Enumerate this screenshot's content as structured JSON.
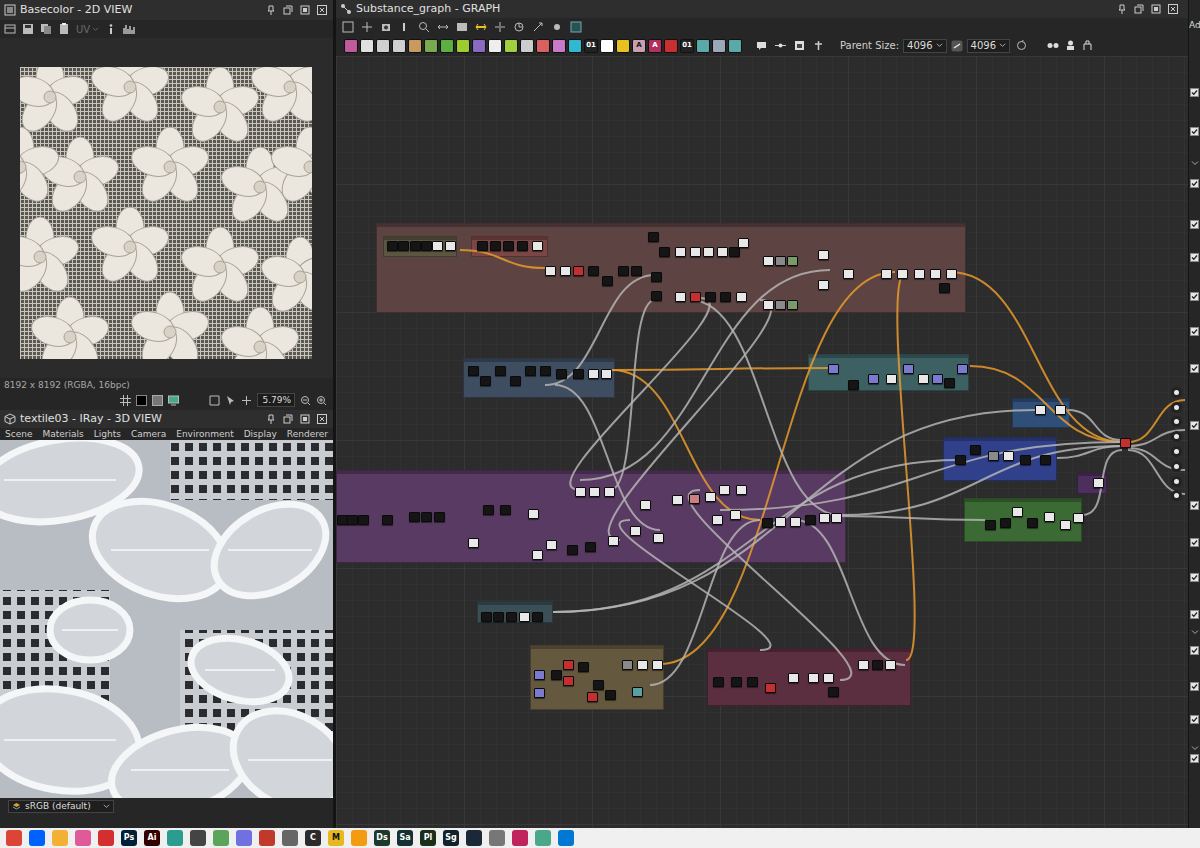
{
  "panels": {
    "view2d": {
      "title": "Basecolor - 2D VIEW",
      "uv": "UV",
      "info": "8192 x 8192 (RGBA, 16bpc)",
      "zoom": "5.79%"
    },
    "view3d": {
      "title": "textile03 - IRay - 3D VIEW",
      "menu": [
        "Scene",
        "Materials",
        "Lights",
        "Camera",
        "Environment",
        "Display",
        "Renderer"
      ],
      "colorspace": "sRGB (default)"
    },
    "graph": {
      "title": "Substance_graph - GRAPH",
      "parent_size_label": "Parent Size:",
      "parent_size": "4096",
      "output_size": "4096",
      "toolbar_icons": [
        {
          "color": "#c05a9a"
        },
        {
          "color": "#e0e0e0"
        },
        {
          "color": "#cfcfcf"
        },
        {
          "color": "#cfcfcf"
        },
        {
          "color": "#c89a60"
        },
        {
          "color": "#7aaa50"
        },
        {
          "color": "#5ab040"
        },
        {
          "color": "#9ccc30"
        },
        {
          "color": "#8a6ac0"
        },
        {
          "color": "#eeeeee"
        },
        {
          "color": "#a0d040"
        },
        {
          "color": "#cccccc"
        },
        {
          "color": "#d86060"
        },
        {
          "color": "#c87ac8"
        },
        {
          "color": "#30b8d0"
        },
        {
          "color": "#222222",
          "glyph": "01"
        },
        {
          "color": "#ffffff"
        },
        {
          "color": "#e8c020"
        },
        {
          "color": "#c8a0b0",
          "glyph": "A"
        },
        {
          "color": "#b03060",
          "glyph": "A"
        },
        {
          "color": "#c83030"
        },
        {
          "color": "#222222",
          "glyph": "01"
        },
        {
          "color": "#5aa8a8"
        },
        {
          "color": "#9aa8b8"
        },
        {
          "color": "#5aa8a8"
        }
      ],
      "frames": [
        {
          "color": "#5e4343"
        },
        {
          "color": "#5b5640"
        },
        {
          "color": "#7a4646"
        },
        {
          "color": "#3e4d60"
        },
        {
          "color": "#3d6163"
        },
        {
          "color": "#2f4f78"
        },
        {
          "color": "#30408a"
        },
        {
          "color": "#583a62"
        },
        {
          "color": "#4c2f5c"
        },
        {
          "color": "#3b6a34"
        },
        {
          "color": "#3a5056"
        },
        {
          "color": "#64593f"
        },
        {
          "color": "#5b2f40"
        }
      ],
      "wires": [
        {
          "color": "#e89a2c"
        },
        {
          "color": "#e89a2c"
        },
        {
          "color": "#e89a2c"
        },
        {
          "color": "#e89a2c"
        },
        {
          "color": "#e89a2c"
        },
        {
          "color": "#e89a2c"
        },
        {
          "color": "#e89a2c"
        },
        {
          "color": "#e89a2c"
        },
        {
          "color": "#b4b4b4"
        },
        {
          "color": "#b4b4b4"
        },
        {
          "color": "#b4b4b4"
        },
        {
          "color": "#b4b4b4"
        },
        {
          "color": "#b4b4b4"
        },
        {
          "color": "#b4b4b4"
        },
        {
          "color": "#b4b4b4"
        },
        {
          "color": "#b4b4b4"
        },
        {
          "color": "#b4b4b4"
        },
        {
          "color": "#b4b4b4"
        },
        {
          "color": "#b4b4b4"
        },
        {
          "color": "#b4b4b4"
        },
        {
          "color": "#b4b4b4"
        },
        {
          "color": "#b4b4b4"
        },
        {
          "color": "#b4b4b4"
        },
        {
          "color": "#b4b4b4"
        },
        {
          "color": "#b4b4b4"
        },
        {
          "color": "#b4b4b4"
        },
        {
          "color": "#b4b4b4"
        },
        {
          "color": "#b4b4b4"
        },
        {
          "color": "#b4b4b4"
        },
        {
          "color": "#b4b4b4"
        }
      ],
      "nodes": [
        {
          "color": "#151515"
        },
        {
          "color": "#151515"
        },
        {
          "color": "#151515"
        },
        {
          "color": "#151515"
        },
        {
          "color": "#e8e8e8"
        },
        {
          "color": "#e8e8e8"
        },
        {
          "color": "#151515"
        },
        {
          "color": "#151515"
        },
        {
          "color": "#151515"
        },
        {
          "color": "#151515"
        },
        {
          "color": "#e8e8e8"
        },
        {
          "color": "#e8e8e8"
        },
        {
          "color": "#e8e8e8"
        },
        {
          "color": "#c43030"
        },
        {
          "color": "#151515"
        },
        {
          "color": "#151515"
        },
        {
          "color": "#151515"
        },
        {
          "color": "#151515"
        },
        {
          "color": "#151515"
        },
        {
          "color": "#151515"
        },
        {
          "color": "#e8e8e8"
        },
        {
          "color": "#e8e8e8"
        },
        {
          "color": "#e8e8e8"
        },
        {
          "color": "#e8e8e8"
        },
        {
          "color": "#151515"
        },
        {
          "color": "#e8e8e8"
        },
        {
          "color": "#151515"
        },
        {
          "color": "#151515"
        },
        {
          "color": "#e8e8e8"
        },
        {
          "color": "#c43030"
        },
        {
          "color": "#151515"
        },
        {
          "color": "#151515"
        },
        {
          "color": "#e8e8e8"
        },
        {
          "color": "#e8e8e8"
        },
        {
          "color": "#8a8a8a"
        },
        {
          "color": "#7a9a6a"
        },
        {
          "color": "#e8e8e8"
        },
        {
          "color": "#8a8a8a"
        },
        {
          "color": "#7a9a6a"
        },
        {
          "color": "#e8e8e8"
        },
        {
          "color": "#e8e8e8"
        },
        {
          "color": "#e8e8e8"
        },
        {
          "color": "#e8e8e8"
        },
        {
          "color": "#e8e8e8"
        },
        {
          "color": "#e8e8e8"
        },
        {
          "color": "#e8e8e8"
        },
        {
          "color": "#e8e8e8"
        },
        {
          "color": "#151515"
        },
        {
          "color": "#151515"
        },
        {
          "color": "#151515"
        },
        {
          "color": "#151515"
        },
        {
          "color": "#151515"
        },
        {
          "color": "#151515"
        },
        {
          "color": "#151515"
        },
        {
          "color": "#151515"
        },
        {
          "color": "#151515"
        },
        {
          "color": "#e8e8e8"
        },
        {
          "color": "#e8e8e8"
        },
        {
          "color": "#7a7ad0"
        },
        {
          "color": "#151515"
        },
        {
          "color": "#7a7ad0"
        },
        {
          "color": "#e8e8e8"
        },
        {
          "color": "#7a7ad0"
        },
        {
          "color": "#e8e8e8"
        },
        {
          "color": "#7a7ad0"
        },
        {
          "color": "#151515"
        },
        {
          "color": "#7a7ad0"
        },
        {
          "color": "#e8e8e8"
        },
        {
          "color": "#e8e8e8"
        },
        {
          "color": "#151515"
        },
        {
          "color": "#151515"
        },
        {
          "color": "#8a8a8a"
        },
        {
          "color": "#e8e8e8"
        },
        {
          "color": "#151515"
        },
        {
          "color": "#151515"
        },
        {
          "color": "#151515"
        },
        {
          "color": "#151515"
        },
        {
          "color": "#151515"
        },
        {
          "color": "#151515"
        },
        {
          "color": "#151515"
        },
        {
          "color": "#151515"
        },
        {
          "color": "#151515"
        },
        {
          "color": "#e8e8e8"
        },
        {
          "color": "#151515"
        },
        {
          "color": "#151515"
        },
        {
          "color": "#e8e8e8"
        },
        {
          "color": "#e8e8e8"
        },
        {
          "color": "#e8e8e8"
        },
        {
          "color": "#e8e8e8"
        },
        {
          "color": "#e8e8e8"
        },
        {
          "color": "#e8e8e8"
        },
        {
          "color": "#151515"
        },
        {
          "color": "#151515"
        },
        {
          "color": "#e8e8e8"
        },
        {
          "color": "#e8e8e8"
        },
        {
          "color": "#e8e8e8"
        },
        {
          "color": "#e8e8e8"
        },
        {
          "color": "#e8e8e8"
        },
        {
          "color": "#c88080"
        },
        {
          "color": "#e8e8e8"
        },
        {
          "color": "#e8e8e8"
        },
        {
          "color": "#e8e8e8"
        },
        {
          "color": "#e8e8e8"
        },
        {
          "color": "#e8e8e8"
        },
        {
          "color": "#151515"
        },
        {
          "color": "#e8e8e8"
        },
        {
          "color": "#e8e8e8"
        },
        {
          "color": "#151515"
        },
        {
          "color": "#e8e8e8"
        },
        {
          "color": "#e8e8e8"
        },
        {
          "color": "#151515"
        },
        {
          "color": "#151515"
        },
        {
          "color": "#e8e8e8"
        },
        {
          "color": "#151515"
        },
        {
          "color": "#e8e8e8"
        },
        {
          "color": "#e8e8e8"
        },
        {
          "color": "#e8e8e8"
        },
        {
          "color": "#e8e8e8"
        },
        {
          "color": "#151515"
        },
        {
          "color": "#151515"
        },
        {
          "color": "#151515"
        },
        {
          "color": "#e8e8e8"
        },
        {
          "color": "#151515"
        },
        {
          "color": "#7a7ad0"
        },
        {
          "color": "#7a7ad0"
        },
        {
          "color": "#151515"
        },
        {
          "color": "#c43030"
        },
        {
          "color": "#c43030"
        },
        {
          "color": "#151515"
        },
        {
          "color": "#151515"
        },
        {
          "color": "#c43030"
        },
        {
          "color": "#8a8a8a"
        },
        {
          "color": "#e8e8e8"
        },
        {
          "color": "#e8e8e8"
        },
        {
          "color": "#151515"
        },
        {
          "color": "#5aa0a0"
        },
        {
          "color": "#151515"
        },
        {
          "color": "#151515"
        },
        {
          "color": "#151515"
        },
        {
          "color": "#c43030"
        },
        {
          "color": "#e8e8e8"
        },
        {
          "color": "#e8e8e8"
        },
        {
          "color": "#e8e8e8"
        },
        {
          "color": "#151515"
        },
        {
          "color": "#e8e8e8"
        },
        {
          "color": "#151515"
        },
        {
          "color": "#e8e8e8"
        },
        {
          "color": "#c43030"
        }
      ]
    }
  },
  "right_strip": {
    "label": "Ad",
    "checkboxes": [
      {
        "checked": true
      },
      {
        "checked": true
      },
      {
        "checked": true
      },
      {
        "checked": true
      },
      {
        "checked": true
      },
      {
        "checked": true
      },
      {
        "checked": true
      },
      {
        "checked": true
      },
      {
        "checked": true
      },
      {
        "checked": true
      },
      {
        "checked": true
      },
      {
        "checked": true
      },
      {
        "checked": true
      },
      {
        "checked": true
      },
      {
        "checked": true
      },
      {
        "checked": true
      },
      {
        "checked": true
      }
    ]
  },
  "taskbar": [
    {
      "color": "#db4437"
    },
    {
      "color": "#0061fe"
    },
    {
      "color": "#f2b134"
    },
    {
      "color": "#e05a9a"
    },
    {
      "color": "#d32f2f"
    },
    {
      "label": "Ps",
      "color": "#001e36"
    },
    {
      "label": "Ai",
      "color": "#330000"
    },
    {
      "color": "#2a9d8f"
    },
    {
      "color": "#444444"
    },
    {
      "color": "#5aa55a"
    },
    {
      "color": "#7070e0"
    },
    {
      "color": "#c0392b"
    },
    {
      "color": "#666666"
    },
    {
      "label": "C",
      "color": "#2b2b2b"
    },
    {
      "label": "M",
      "color": "#e9b820"
    },
    {
      "color": "#f39c12"
    },
    {
      "label": "Ds",
      "color": "#1c3a2c"
    },
    {
      "label": "Sa",
      "color": "#143030"
    },
    {
      "label": "Pl",
      "color": "#1a2e1a"
    },
    {
      "label": "Sg",
      "color": "#13232b"
    },
    {
      "color": "#1b2838"
    },
    {
      "color": "#777777"
    },
    {
      "color": "#c0245c"
    },
    {
      "color": "#4aa88a"
    },
    {
      "color": "#0078d4"
    }
  ]
}
